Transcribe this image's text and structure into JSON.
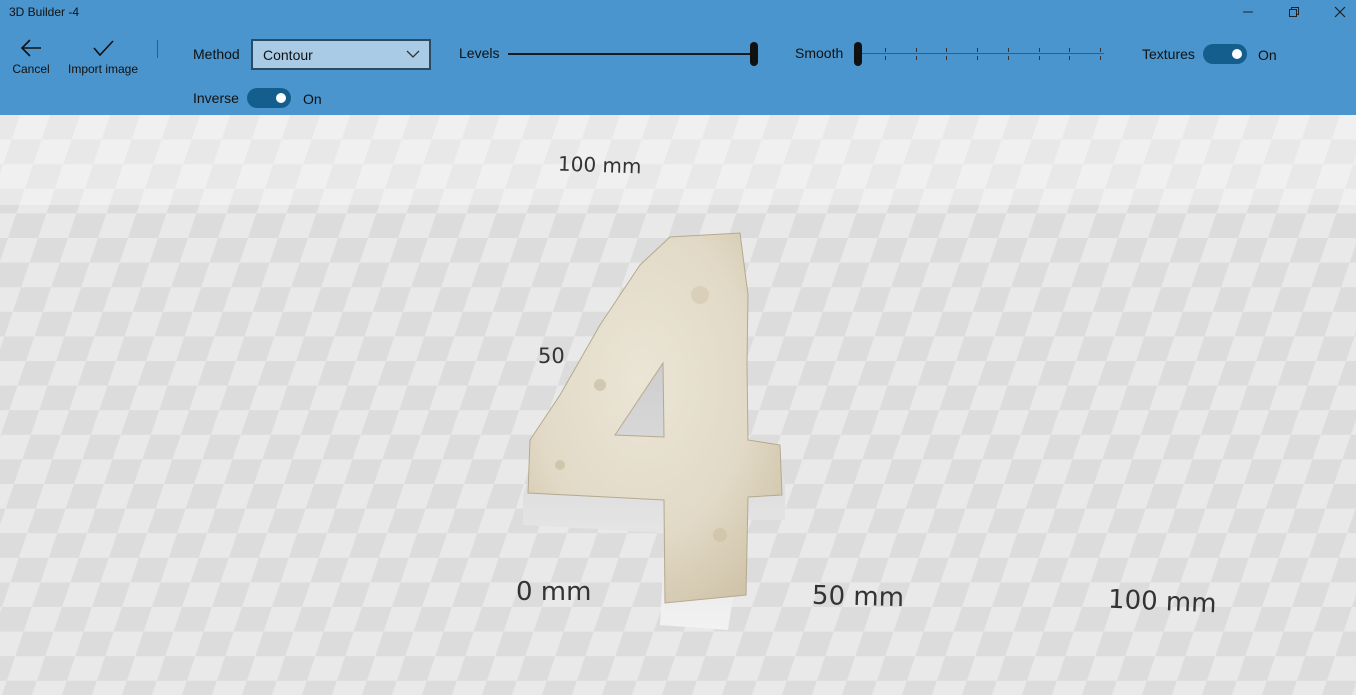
{
  "window": {
    "title": "3D Builder -4",
    "controls": [
      "minimize-icon",
      "restore-icon",
      "close-icon"
    ]
  },
  "toolbar": {
    "cancel_label": "Cancel",
    "import_label": "Import image",
    "method_label": "Method",
    "method_value": "Contour",
    "levels_label": "Levels",
    "levels_value": 1.0,
    "smooth_label": "Smooth",
    "smooth_value": 0.0,
    "textures_label": "Textures",
    "textures_state": "On",
    "inverse_label": "Inverse",
    "inverse_state": "On"
  },
  "viewport": {
    "ruler_labels": {
      "back_100": "100 mm",
      "left_50": "50",
      "front_0": "0 mm",
      "front_50": "50 mm",
      "front_100": "100 mm"
    }
  },
  "colors": {
    "toolbar_bg": "#4a95cd",
    "toggle_on": "#135e8c",
    "select_bg": "#a9cbe6"
  }
}
